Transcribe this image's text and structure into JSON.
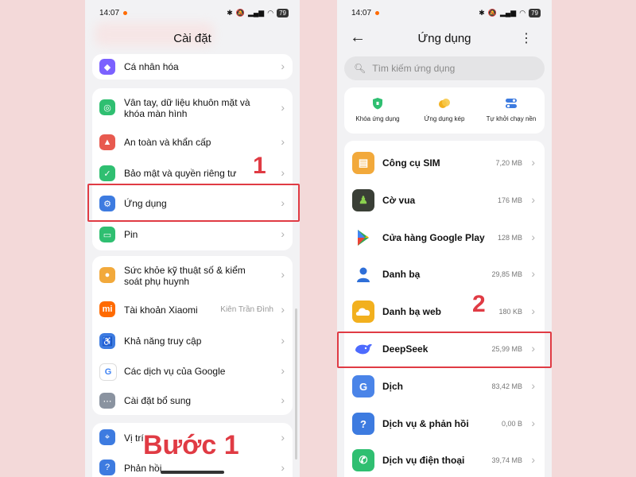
{
  "status_bar": {
    "time": "14:07",
    "battery": "79"
  },
  "left_screen": {
    "title": "Cài đặt",
    "items": [
      {
        "label": "Cá nhân hóa",
        "icon": "palette-icon",
        "color": "#7b61ff"
      },
      {
        "label": "Vân tay, dữ liệu khuôn mặt và khóa màn hình",
        "icon": "fingerprint-icon",
        "color": "#2fbf71"
      },
      {
        "label": "An toàn và khẩn cấp",
        "icon": "emergency-icon",
        "color": "#e85a4f"
      },
      {
        "label": "Bảo mật và quyền riêng tư",
        "icon": "shield-icon",
        "color": "#2fbf71"
      },
      {
        "label": "Ứng dụng",
        "icon": "apps-gear-icon",
        "color": "#3d7be0"
      },
      {
        "label": "Pin",
        "icon": "battery-icon",
        "color": "#2fbf71"
      },
      {
        "label": "Sức khỏe kỹ thuật số & kiểm soát phụ huynh",
        "icon": "digital-wellbeing-icon",
        "color": "#f2a93b"
      },
      {
        "label": "Tài khoản Xiaomi",
        "icon": "xiaomi-icon",
        "color": "#ff6a00",
        "extra": "Kiên Trần Đình"
      },
      {
        "label": "Khả năng truy cập",
        "icon": "accessibility-icon",
        "color": "#3d7be0"
      },
      {
        "label": "Các dịch vụ của Google",
        "icon": "google-icon",
        "color": "#ffffff"
      },
      {
        "label": "Cài đặt bổ sung",
        "icon": "more-settings-icon",
        "color": "#8a93a0"
      },
      {
        "label": "Vị trí",
        "icon": "location-icon",
        "color": "#3d7be0"
      },
      {
        "label": "Phản hồi",
        "icon": "feedback-icon",
        "color": "#3d7be0"
      }
    ],
    "annotation_number": "1",
    "annotation_step": "Bước 1"
  },
  "right_screen": {
    "title": "Ứng dụng",
    "search_placeholder": "Tìm kiếm ứng dụng",
    "shortcuts": [
      {
        "label": "Khóa ứng dụng",
        "icon": "app-lock-shield-icon",
        "color": "#2fbf71"
      },
      {
        "label": "Ứng dụng kép",
        "icon": "dual-apps-icon",
        "color": "#f2b01e"
      },
      {
        "label": "Tự khởi chạy nền",
        "icon": "autostart-toggle-icon",
        "color": "#3d7be0"
      }
    ],
    "apps": [
      {
        "name": "Công cụ SIM",
        "size": "7,20 MB",
        "icon": "sim-toolkit-icon",
        "color": "#f2a93b"
      },
      {
        "name": "Cờ vua",
        "size": "176 MB",
        "icon": "chess-icon",
        "color": "#3a3f36"
      },
      {
        "name": "Cửa hàng Google Play",
        "size": "128 MB",
        "icon": "google-play-icon",
        "color": "#ffffff"
      },
      {
        "name": "Danh bạ",
        "size": "29,85 MB",
        "icon": "contacts-icon",
        "color": "#ffffff"
      },
      {
        "name": "Danh bạ web",
        "size": "180 KB",
        "icon": "web-contacts-icon",
        "color": "#f2b01e"
      },
      {
        "name": "DeepSeek",
        "size": "25,99 MB",
        "icon": "deepseek-whale-icon",
        "color": "#ffffff"
      },
      {
        "name": "Dịch",
        "size": "83,42 MB",
        "icon": "translate-icon",
        "color": "#4a84e8"
      },
      {
        "name": "Dịch vụ & phản hồi",
        "size": "0,00 B",
        "icon": "service-feedback-icon",
        "color": "#3d7be0"
      },
      {
        "name": "Dịch vụ điện thoại",
        "size": "39,74 MB",
        "icon": "phone-icon",
        "color": "#2fbf71"
      }
    ],
    "annotation_number": "2"
  }
}
